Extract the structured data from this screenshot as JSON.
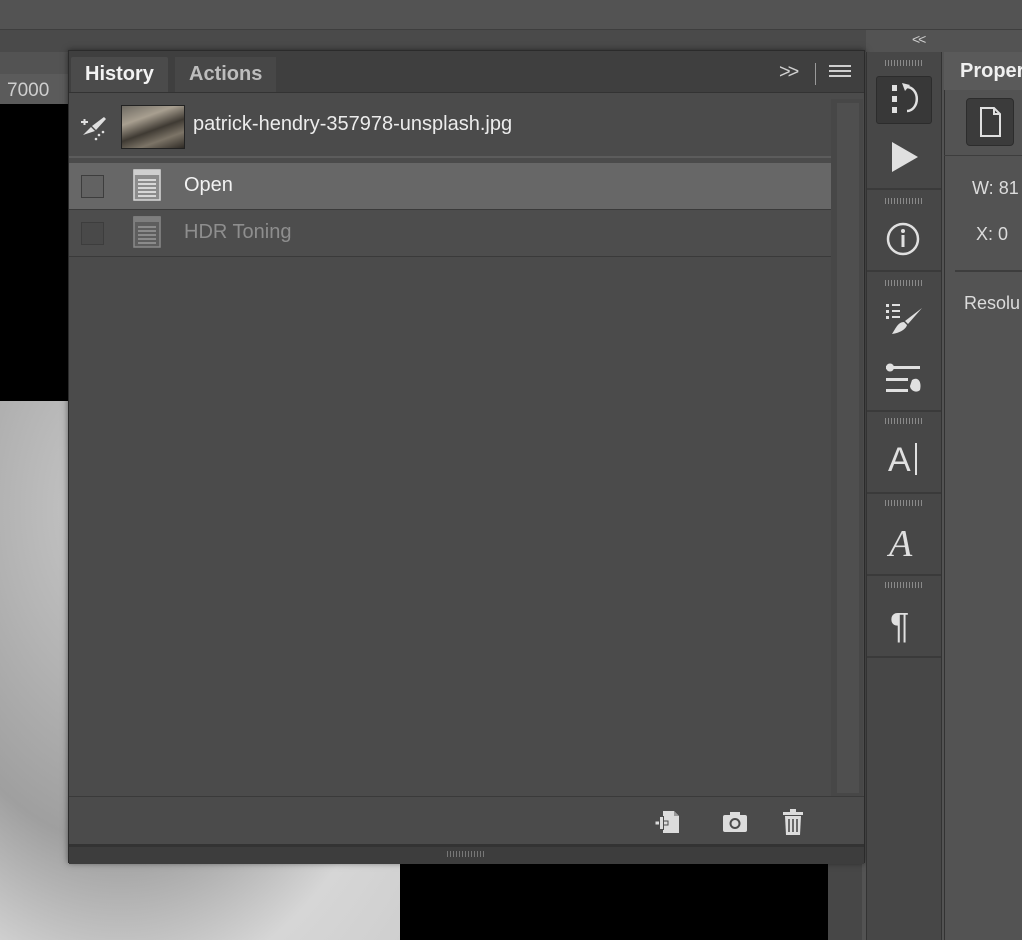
{
  "ruler": {
    "label": "7000"
  },
  "history_panel": {
    "tabs": [
      {
        "label": "History"
      },
      {
        "label": "Actions"
      }
    ],
    "collapse_label": ">>",
    "snapshot": {
      "name": "patrick-hendry-357978-unsplash.jpg"
    },
    "items": [
      {
        "label": "Open",
        "state": "active"
      },
      {
        "label": "HDR Toning",
        "state": "inactive"
      }
    ],
    "footer_icons": [
      "new-document-from-state-icon",
      "camera-snapshot-icon",
      "trash-icon"
    ]
  },
  "tool_strip": {
    "collapse_label": "<<",
    "buttons": [
      "history-icon",
      "play-actions-icon",
      "info-icon",
      "brush-presets-icon",
      "brush-settings-icon",
      "character-icon",
      "glyphs-icon",
      "paragraph-icon"
    ]
  },
  "properties_panel": {
    "title": "Proper",
    "w_label": "W:",
    "w_value": "81",
    "x_label": "X:",
    "x_value": "0",
    "resolution_label": "Resolu"
  }
}
